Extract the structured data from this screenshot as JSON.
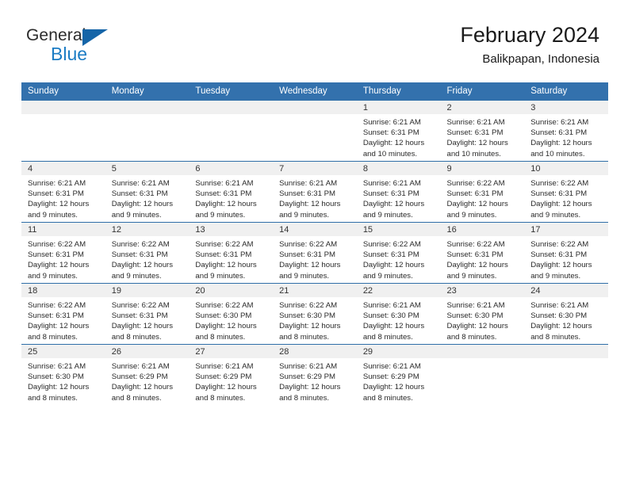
{
  "brand": {
    "name_top": "General",
    "name_bottom": "Blue",
    "accent_color": "#1b7cc4",
    "triangle_color": "#1565a8"
  },
  "header": {
    "title": "February 2024",
    "subtitle": "Balikpapan, Indonesia"
  },
  "theme": {
    "header_blue": "#3371ad",
    "row_line_blue": "#2f6ea8",
    "day_band_gray": "#f0f0f0"
  },
  "weekdays": [
    "Sunday",
    "Monday",
    "Tuesday",
    "Wednesday",
    "Thursday",
    "Friday",
    "Saturday"
  ],
  "weeks": [
    [
      {
        "day": "",
        "blank": true
      },
      {
        "day": "",
        "blank": true
      },
      {
        "day": "",
        "blank": true
      },
      {
        "day": "",
        "blank": true
      },
      {
        "day": "1",
        "sunrise": "Sunrise: 6:21 AM",
        "sunset": "Sunset: 6:31 PM",
        "daylight1": "Daylight: 12 hours",
        "daylight2": "and 10 minutes."
      },
      {
        "day": "2",
        "sunrise": "Sunrise: 6:21 AM",
        "sunset": "Sunset: 6:31 PM",
        "daylight1": "Daylight: 12 hours",
        "daylight2": "and 10 minutes."
      },
      {
        "day": "3",
        "sunrise": "Sunrise: 6:21 AM",
        "sunset": "Sunset: 6:31 PM",
        "daylight1": "Daylight: 12 hours",
        "daylight2": "and 10 minutes."
      }
    ],
    [
      {
        "day": "4",
        "sunrise": "Sunrise: 6:21 AM",
        "sunset": "Sunset: 6:31 PM",
        "daylight1": "Daylight: 12 hours",
        "daylight2": "and 9 minutes."
      },
      {
        "day": "5",
        "sunrise": "Sunrise: 6:21 AM",
        "sunset": "Sunset: 6:31 PM",
        "daylight1": "Daylight: 12 hours",
        "daylight2": "and 9 minutes."
      },
      {
        "day": "6",
        "sunrise": "Sunrise: 6:21 AM",
        "sunset": "Sunset: 6:31 PM",
        "daylight1": "Daylight: 12 hours",
        "daylight2": "and 9 minutes."
      },
      {
        "day": "7",
        "sunrise": "Sunrise: 6:21 AM",
        "sunset": "Sunset: 6:31 PM",
        "daylight1": "Daylight: 12 hours",
        "daylight2": "and 9 minutes."
      },
      {
        "day": "8",
        "sunrise": "Sunrise: 6:21 AM",
        "sunset": "Sunset: 6:31 PM",
        "daylight1": "Daylight: 12 hours",
        "daylight2": "and 9 minutes."
      },
      {
        "day": "9",
        "sunrise": "Sunrise: 6:22 AM",
        "sunset": "Sunset: 6:31 PM",
        "daylight1": "Daylight: 12 hours",
        "daylight2": "and 9 minutes."
      },
      {
        "day": "10",
        "sunrise": "Sunrise: 6:22 AM",
        "sunset": "Sunset: 6:31 PM",
        "daylight1": "Daylight: 12 hours",
        "daylight2": "and 9 minutes."
      }
    ],
    [
      {
        "day": "11",
        "sunrise": "Sunrise: 6:22 AM",
        "sunset": "Sunset: 6:31 PM",
        "daylight1": "Daylight: 12 hours",
        "daylight2": "and 9 minutes."
      },
      {
        "day": "12",
        "sunrise": "Sunrise: 6:22 AM",
        "sunset": "Sunset: 6:31 PM",
        "daylight1": "Daylight: 12 hours",
        "daylight2": "and 9 minutes."
      },
      {
        "day": "13",
        "sunrise": "Sunrise: 6:22 AM",
        "sunset": "Sunset: 6:31 PM",
        "daylight1": "Daylight: 12 hours",
        "daylight2": "and 9 minutes."
      },
      {
        "day": "14",
        "sunrise": "Sunrise: 6:22 AM",
        "sunset": "Sunset: 6:31 PM",
        "daylight1": "Daylight: 12 hours",
        "daylight2": "and 9 minutes."
      },
      {
        "day": "15",
        "sunrise": "Sunrise: 6:22 AM",
        "sunset": "Sunset: 6:31 PM",
        "daylight1": "Daylight: 12 hours",
        "daylight2": "and 9 minutes."
      },
      {
        "day": "16",
        "sunrise": "Sunrise: 6:22 AM",
        "sunset": "Sunset: 6:31 PM",
        "daylight1": "Daylight: 12 hours",
        "daylight2": "and 9 minutes."
      },
      {
        "day": "17",
        "sunrise": "Sunrise: 6:22 AM",
        "sunset": "Sunset: 6:31 PM",
        "daylight1": "Daylight: 12 hours",
        "daylight2": "and 9 minutes."
      }
    ],
    [
      {
        "day": "18",
        "sunrise": "Sunrise: 6:22 AM",
        "sunset": "Sunset: 6:31 PM",
        "daylight1": "Daylight: 12 hours",
        "daylight2": "and 8 minutes."
      },
      {
        "day": "19",
        "sunrise": "Sunrise: 6:22 AM",
        "sunset": "Sunset: 6:31 PM",
        "daylight1": "Daylight: 12 hours",
        "daylight2": "and 8 minutes."
      },
      {
        "day": "20",
        "sunrise": "Sunrise: 6:22 AM",
        "sunset": "Sunset: 6:30 PM",
        "daylight1": "Daylight: 12 hours",
        "daylight2": "and 8 minutes."
      },
      {
        "day": "21",
        "sunrise": "Sunrise: 6:22 AM",
        "sunset": "Sunset: 6:30 PM",
        "daylight1": "Daylight: 12 hours",
        "daylight2": "and 8 minutes."
      },
      {
        "day": "22",
        "sunrise": "Sunrise: 6:21 AM",
        "sunset": "Sunset: 6:30 PM",
        "daylight1": "Daylight: 12 hours",
        "daylight2": "and 8 minutes."
      },
      {
        "day": "23",
        "sunrise": "Sunrise: 6:21 AM",
        "sunset": "Sunset: 6:30 PM",
        "daylight1": "Daylight: 12 hours",
        "daylight2": "and 8 minutes."
      },
      {
        "day": "24",
        "sunrise": "Sunrise: 6:21 AM",
        "sunset": "Sunset: 6:30 PM",
        "daylight1": "Daylight: 12 hours",
        "daylight2": "and 8 minutes."
      }
    ],
    [
      {
        "day": "25",
        "sunrise": "Sunrise: 6:21 AM",
        "sunset": "Sunset: 6:30 PM",
        "daylight1": "Daylight: 12 hours",
        "daylight2": "and 8 minutes."
      },
      {
        "day": "26",
        "sunrise": "Sunrise: 6:21 AM",
        "sunset": "Sunset: 6:29 PM",
        "daylight1": "Daylight: 12 hours",
        "daylight2": "and 8 minutes."
      },
      {
        "day": "27",
        "sunrise": "Sunrise: 6:21 AM",
        "sunset": "Sunset: 6:29 PM",
        "daylight1": "Daylight: 12 hours",
        "daylight2": "and 8 minutes."
      },
      {
        "day": "28",
        "sunrise": "Sunrise: 6:21 AM",
        "sunset": "Sunset: 6:29 PM",
        "daylight1": "Daylight: 12 hours",
        "daylight2": "and 8 minutes."
      },
      {
        "day": "29",
        "sunrise": "Sunrise: 6:21 AM",
        "sunset": "Sunset: 6:29 PM",
        "daylight1": "Daylight: 12 hours",
        "daylight2": "and 8 minutes."
      },
      {
        "day": "",
        "blank": true
      },
      {
        "day": "",
        "blank": true
      }
    ]
  ]
}
